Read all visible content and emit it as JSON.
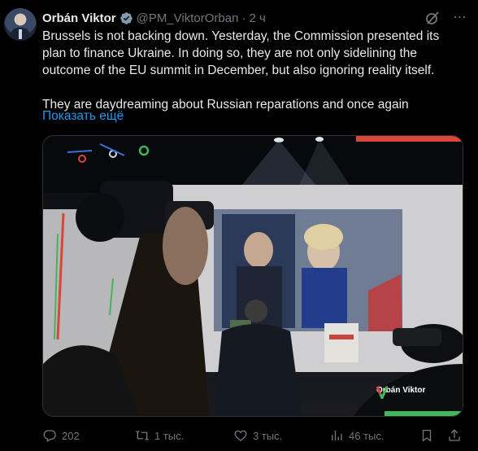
{
  "tweet": {
    "author_name": "Orbán Viktor",
    "handle": "@PM_ViktorOrban",
    "separator": "·",
    "time": "2 ч",
    "text": "Brussels is not backing down. Yesterday, the Commission presented its plan to finance Ukraine. In doing so, they are not only sidelining the outcome of the EU summit in December, but also ignoring reality itself.\n\nThey are daydreaming about Russian reparations and once again",
    "show_more": "Показать ещё",
    "media_logo_text": "Orbán Viktor"
  },
  "actions": {
    "reply_count": "202",
    "repost_count": "1 тыс.",
    "like_count": "3 тыс.",
    "view_count": "46 тыс."
  },
  "icons": {
    "verified": "verified-badge-icon",
    "grok": "grok-icon",
    "more": "more-icon",
    "reply": "reply-icon",
    "repost": "repost-icon",
    "like": "heart-icon",
    "views": "views-icon",
    "bookmark": "bookmark-icon",
    "share": "share-icon"
  },
  "colors": {
    "accent": "#1d9bf0",
    "muted": "#71767b",
    "text": "#e7e9ea",
    "background": "#000000"
  }
}
